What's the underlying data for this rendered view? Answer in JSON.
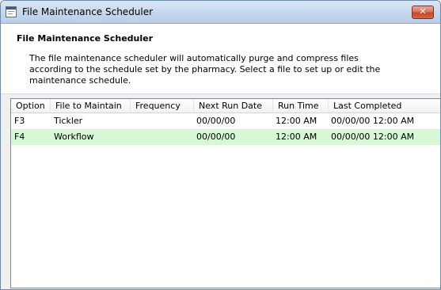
{
  "window": {
    "title": "File Maintenance Scheduler",
    "close_glyph": "✕"
  },
  "header": {
    "heading": "File Maintenance Scheduler",
    "description": "The file maintenance scheduler will automatically purge and compress files according to the schedule set by the pharmacy. Select a file to set up or edit the maintenance schedule."
  },
  "table": {
    "columns": [
      "Option",
      "File to Maintain",
      "Frequency",
      "Next Run Date",
      "Run Time",
      "Last Completed"
    ],
    "rows": [
      {
        "option": "F3",
        "file": "Tickler",
        "frequency": "",
        "next_run_date": "00/00/00",
        "run_time": "12:00 AM",
        "last_completed": "00/00/00 12:00 AM"
      },
      {
        "option": "F4",
        "file": "Workflow",
        "frequency": "",
        "next_run_date": "00/00/00",
        "run_time": "12:00 AM",
        "last_completed": "00/00/00 12:00 AM"
      }
    ],
    "selected_row_color": "#d6f8d4"
  },
  "icons": {
    "app": "window-app-icon",
    "close": "close-icon"
  }
}
